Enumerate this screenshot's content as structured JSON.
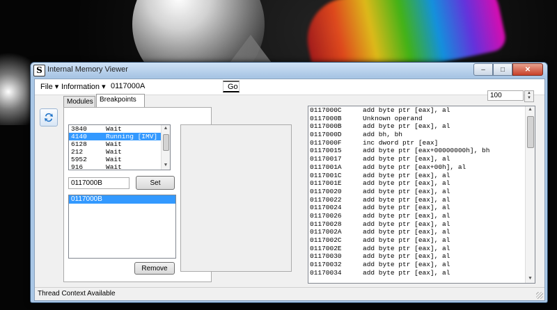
{
  "window": {
    "title": "Internal Memory Viewer",
    "icon_name": "app-s-icon",
    "caption_buttons": {
      "minimize": "–",
      "maximize": "□",
      "close": "✕"
    }
  },
  "menubar": {
    "file": "File",
    "information": "Information",
    "address_value": "0117000A",
    "go_label": "Go"
  },
  "tabs": [
    "Modules",
    "Breakpoints"
  ],
  "threads": [
    {
      "id": "3840",
      "state": "Wait"
    },
    {
      "id": "4140",
      "state": "Running [IMV]"
    },
    {
      "id": "6128",
      "state": "Wait"
    },
    {
      "id": "212",
      "state": "Wait"
    },
    {
      "id": "5952",
      "state": "Wait"
    },
    {
      "id": "916",
      "state": "Wait"
    }
  ],
  "breakpoint": {
    "input_value": "0117000B",
    "set_label": "Set",
    "list": [
      "0117000B"
    ],
    "remove_label": "Remove"
  },
  "line_count": "100",
  "disassembly": [
    {
      "addr": "0117000C",
      "ins": "add byte ptr [eax], al"
    },
    {
      "addr": "0117000B",
      "ins": "Unknown operand"
    },
    {
      "addr": "0117000B",
      "ins": "add byte ptr [eax], al"
    },
    {
      "addr": "0117000D",
      "ins": "add bh, bh"
    },
    {
      "addr": "0117000F",
      "ins": "inc dword ptr [eax]"
    },
    {
      "addr": "01170015",
      "ins": "add byte ptr [eax+00000000h], bh"
    },
    {
      "addr": "01170017",
      "ins": "add byte ptr [eax], al"
    },
    {
      "addr": "0117001A",
      "ins": "add byte ptr [eax+00h], al"
    },
    {
      "addr": "0117001C",
      "ins": "add byte ptr [eax], al"
    },
    {
      "addr": "0117001E",
      "ins": "add byte ptr [eax], al"
    },
    {
      "addr": "01170020",
      "ins": "add byte ptr [eax], al"
    },
    {
      "addr": "01170022",
      "ins": "add byte ptr [eax], al"
    },
    {
      "addr": "01170024",
      "ins": "add byte ptr [eax], al"
    },
    {
      "addr": "01170026",
      "ins": "add byte ptr [eax], al"
    },
    {
      "addr": "01170028",
      "ins": "add byte ptr [eax], al"
    },
    {
      "addr": "0117002A",
      "ins": "add byte ptr [eax], al"
    },
    {
      "addr": "0117002C",
      "ins": "add byte ptr [eax], al"
    },
    {
      "addr": "0117002E",
      "ins": "add byte ptr [eax], al"
    },
    {
      "addr": "01170030",
      "ins": "add byte ptr [eax], al"
    },
    {
      "addr": "01170032",
      "ins": "add byte ptr [eax], al"
    },
    {
      "addr": "01170034",
      "ins": "add byte ptr [eax], al"
    }
  ],
  "status": "Thread Context Available",
  "colors": {
    "selection": "#3399ff",
    "titlebar": "#a9c7e6"
  }
}
